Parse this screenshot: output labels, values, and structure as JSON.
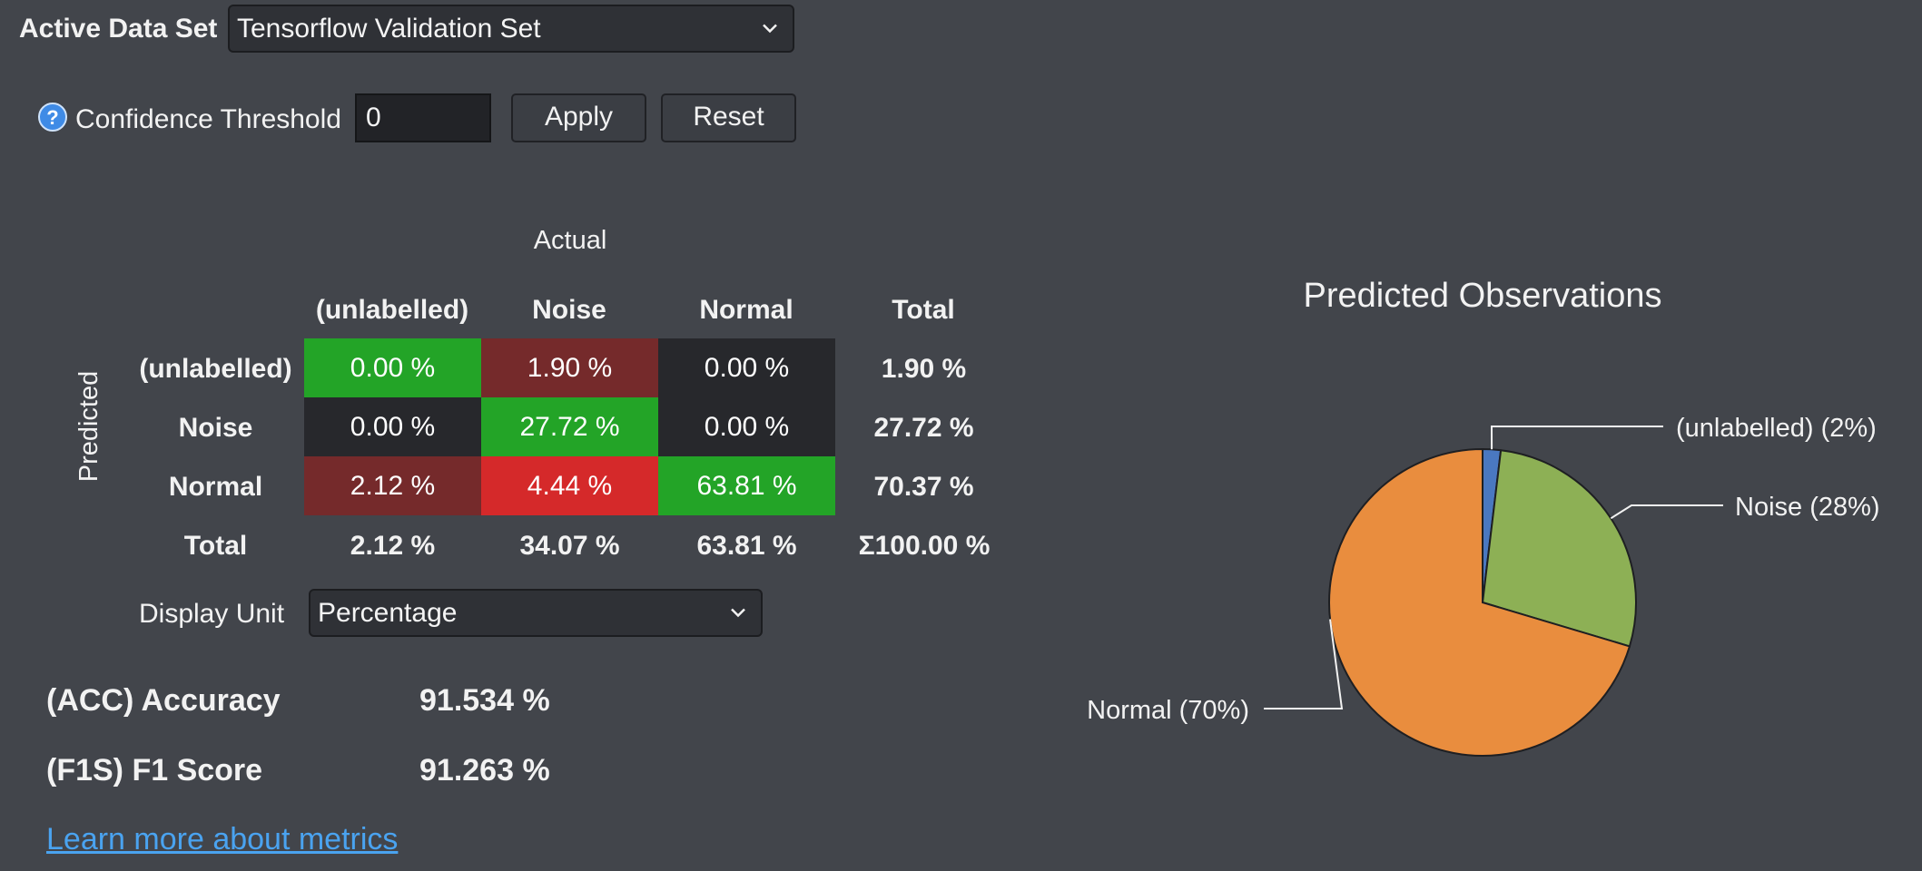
{
  "dataset": {
    "label": "Active Data Set",
    "selected": "Tensorflow Validation Set"
  },
  "threshold": {
    "label": "Confidence Threshold",
    "value": "0",
    "apply_label": "Apply",
    "reset_label": "Reset",
    "help_icon": "question-circle-icon"
  },
  "matrix": {
    "actual_title": "Actual",
    "predicted_title": "Predicted",
    "columns": [
      "(unlabelled)",
      "Noise",
      "Normal",
      "Total"
    ],
    "rows": [
      {
        "label": "(unlabelled)",
        "cells": [
          "0.00 %",
          "1.90 %",
          "0.00 %"
        ],
        "total": "1.90 %"
      },
      {
        "label": "Noise",
        "cells": [
          "0.00 %",
          "27.72 %",
          "0.00 %"
        ],
        "total": "27.72 %"
      },
      {
        "label": "Normal",
        "cells": [
          "2.12 %",
          "4.44 %",
          "63.81 %"
        ],
        "total": "70.37 %"
      }
    ],
    "total_row": {
      "label": "Total",
      "cells": [
        "2.12 %",
        "34.07 %",
        "63.81 %"
      ],
      "total": "Σ100.00 %"
    },
    "cell_colors": [
      [
        "#23a427",
        "#752a2b",
        "#27282c"
      ],
      [
        "#27282c",
        "#23a427",
        "#27282c"
      ],
      [
        "#752a2b",
        "#d5292a",
        "#23a427"
      ]
    ]
  },
  "display_unit": {
    "label": "Display Unit",
    "selected": "Percentage"
  },
  "metrics": {
    "accuracy_label": "(ACC) Accuracy",
    "accuracy_value": "91.534 %",
    "f1_label": "(F1S) F1 Score",
    "f1_value": "91.263 %",
    "learn_more": "Learn more about metrics"
  },
  "chart_data": {
    "type": "pie",
    "title": "Predicted Observations",
    "slices": [
      {
        "name": "(unlabelled)",
        "label": "(unlabelled) (2%)",
        "value": 1.9,
        "color": "#4a78c0"
      },
      {
        "name": "Noise",
        "label": "Noise (28%)",
        "value": 27.72,
        "color": "#8db055"
      },
      {
        "name": "Normal",
        "label": "Normal (70%)",
        "value": 70.37,
        "color": "#e98d3e"
      }
    ]
  }
}
